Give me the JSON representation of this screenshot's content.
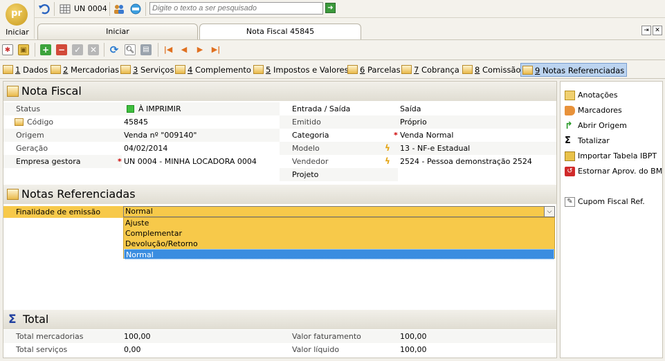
{
  "logo": {
    "text": "pr",
    "label": "Iniciar"
  },
  "topbar": {
    "unit_label": "UN 0004",
    "search_placeholder": "Digite o texto a ser pesquisado",
    "go_icon": "arrow-right-icon"
  },
  "tabs": [
    {
      "label": "Iniciar",
      "active": false
    },
    {
      "label": "Nota Fiscal 45845",
      "active": true
    }
  ],
  "section_tabs": [
    {
      "num": "1",
      "label": " Dados"
    },
    {
      "num": "2",
      "label": " Mercadorias"
    },
    {
      "num": "3",
      "label": " Serviços"
    },
    {
      "num": "4",
      "label": " Complemento"
    },
    {
      "num": "5",
      "label": " Impostos e Valores"
    },
    {
      "num": "6",
      "label": " Parcelas"
    },
    {
      "num": "7",
      "label": " Cobrança"
    },
    {
      "num": "8",
      "label": " Comissão"
    },
    {
      "num": "9",
      "label": " Notas Referenciadas"
    }
  ],
  "nota_fiscal": {
    "title": "Nota Fiscal",
    "left": [
      {
        "label": "Status",
        "value": "À IMPRIMIR"
      },
      {
        "label": "Código",
        "value": "45845"
      },
      {
        "label": "Origem",
        "value": "Venda nº \"009140\""
      },
      {
        "label": "Geração",
        "value": "04/02/2014"
      },
      {
        "label": "Empresa gestora",
        "value": "UN 0004 - MINHA LOCADORA 0004"
      }
    ],
    "right": [
      {
        "label": "Entrada / Saída",
        "value": "Saída"
      },
      {
        "label": "Emitido",
        "value": "Próprio"
      },
      {
        "label": "Categoria",
        "value": "Venda Normal"
      },
      {
        "label": "Modelo",
        "value": "13 - NF-e Estadual"
      },
      {
        "label": "Vendedor",
        "value": "2524 - Pessoa demonstração 2524"
      },
      {
        "label": "Projeto",
        "value": ""
      }
    ]
  },
  "notas_referenciadas": {
    "title": "Notas Referenciadas",
    "finalidade_label": "Finalidade de emissão",
    "finalidade_value": "Normal",
    "options": [
      "Ajuste",
      "Complementar",
      "Devolução/Retorno",
      "Normal"
    ]
  },
  "total": {
    "title": "Total",
    "left": [
      {
        "label": "Total mercadorias",
        "value": "100,00"
      },
      {
        "label": "Total serviços",
        "value": "0,00"
      }
    ],
    "right": [
      {
        "label": "Valor faturamento",
        "value": "100,00"
      },
      {
        "label": "Valor líquido",
        "value": "100,00"
      }
    ]
  },
  "actions": [
    "Anotações",
    "Marcadores",
    "Abrir Origem",
    "Totalizar",
    "Importar Tabela IBPT",
    "Estornar Aprov. do BM",
    "Cupom Fiscal Ref."
  ],
  "colors": {
    "accent_selected": "#bcd4f0",
    "dropdown_bg": "#f7c94a",
    "status_green": "#3fbf3f",
    "required": "#cc0000"
  }
}
